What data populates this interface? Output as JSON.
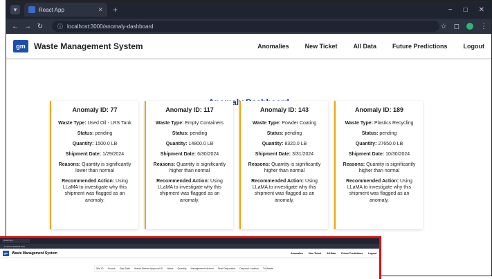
{
  "browser": {
    "tab_title": "React App",
    "url": "localhost:3000/anomaly-dashboard",
    "window_buttons": [
      "−",
      "□",
      "✕"
    ]
  },
  "app": {
    "logo": "gm",
    "title": "Waste Management System",
    "nav": [
      "Anomalies",
      "New Ticket",
      "All Data",
      "Future Predictions",
      "Logout"
    ]
  },
  "dashboard": {
    "title": "Anomaly Dashboard",
    "labels": {
      "id": "Anomaly ID:",
      "waste_type": "Waste Type:",
      "status": "Status:",
      "quantity": "Quantity:",
      "shipment_date": "Shipment Date:",
      "reasons": "Reasons:",
      "action": "Recommended Action:"
    },
    "cards": [
      {
        "id": "77",
        "waste_type": "Used Oil - LRS Tank",
        "status": "pending",
        "quantity": "1500.0 LB",
        "shipment_date": "1/29/2024",
        "reasons": "Quantity is significantly lower than normal",
        "action": "Using LLaMA to investigate why this shipment was flagged as an anomaly."
      },
      {
        "id": "117",
        "waste_type": "Empty Containers",
        "status": "pending",
        "quantity": "14800.0 LB",
        "shipment_date": "6/30/2024",
        "reasons": "Quantity is significantly higher than normal",
        "action": "Using LLaMA to investigate why this shipment was flagged as an anomaly."
      },
      {
        "id": "143",
        "waste_type": "Powder Coating",
        "status": "pending",
        "quantity": "8320.0 LB",
        "shipment_date": "3/31/2024",
        "reasons": "Quantity is significantly higher than normal",
        "action": "Using LLaMA to investigate why this shipment was flagged as an anomaly."
      },
      {
        "id": "189",
        "waste_type": "Plastics Recycling",
        "status": "pending",
        "quantity": "27650.0 LB",
        "shipment_date": "10/30/2024",
        "reasons": "Quantity is significantly higher than normal",
        "action": "Using LLaMA to investigate why this shipment was flagged as an anomaly."
      }
    ]
  },
  "overlay": {
    "tab_title": "React App",
    "url": "localhost:3000/all-data",
    "title": "Waste Management System",
    "nav": [
      "Anomalies",
      "New Ticket",
      "All Data",
      "Future Predictions",
      "Logout"
    ],
    "columns": [
      "Site ID",
      "Source",
      "Ship Date",
      "Waste Stream Approval ID",
      "Name",
      "Quantity",
      "Management Method",
      "Final Disposition",
      "Disposal Location",
      "Tri Waste"
    ]
  },
  "colors": {
    "accent": "#f0a500",
    "title": "#1f3c88",
    "overlay_border": "#d11111"
  }
}
